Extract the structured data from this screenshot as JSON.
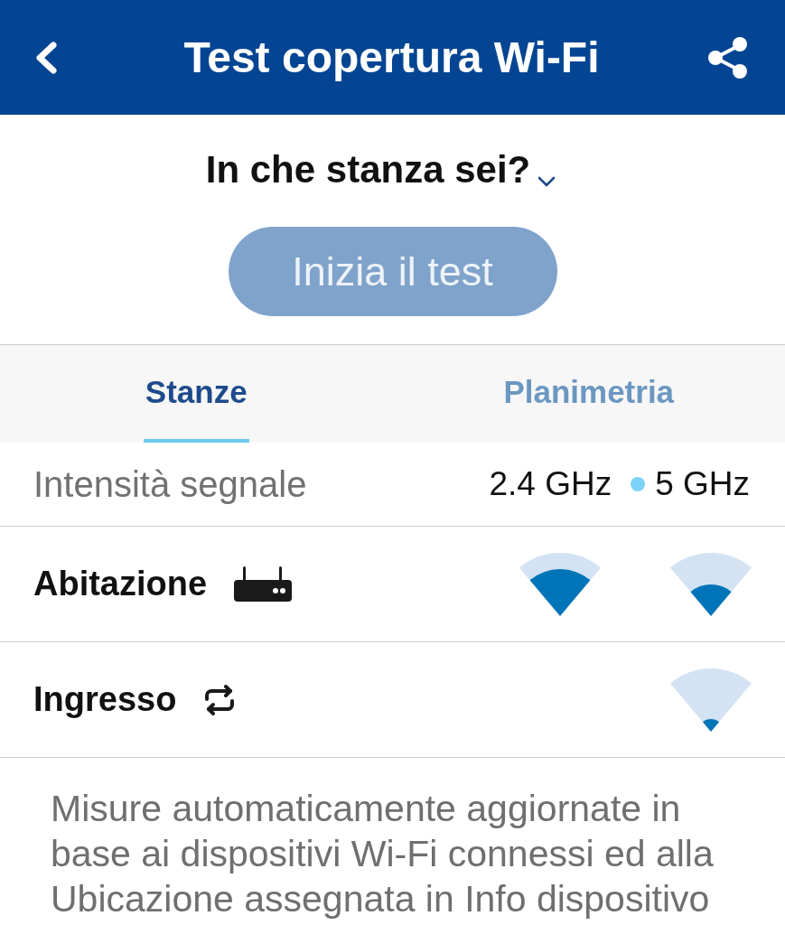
{
  "header": {
    "title": "Test copertura Wi-Fi"
  },
  "room_picker": {
    "label": "In che stanza sei?"
  },
  "start_button": {
    "label": "Inizia il test",
    "disabled": true
  },
  "tabs": [
    {
      "label": "Stanze",
      "selected": true
    },
    {
      "label": "Planimetria",
      "selected": false
    }
  ],
  "signal_header": {
    "label": "Intensità segnale",
    "bands": [
      "2.4 GHz",
      "5 GHz"
    ]
  },
  "rooms": [
    {
      "name": "Abitazione",
      "kind": "router",
      "signal_24ghz": {
        "kind": "strong"
      },
      "signal_5ghz": {
        "kind": "medium"
      }
    },
    {
      "name": "Ingresso",
      "kind": "repeater",
      "signal_5ghz": {
        "kind": "weak"
      }
    }
  ],
  "note": "Misure automaticamente aggiornate in base ai dispositivi Wi-Fi connessi ed alla Ubicazione assegnata in Info dispositivo"
}
